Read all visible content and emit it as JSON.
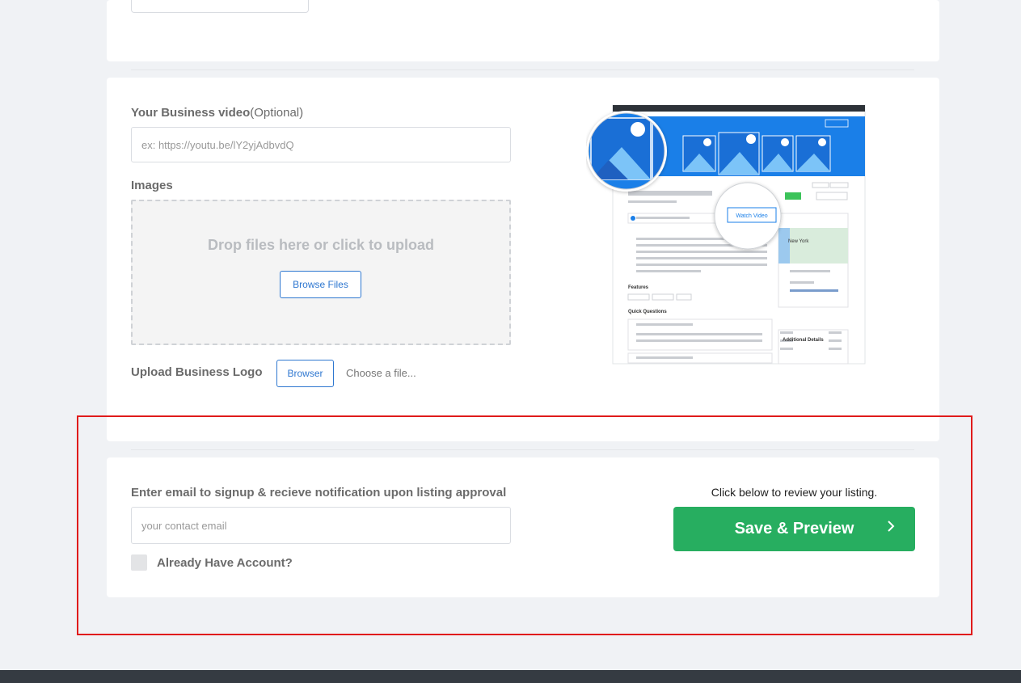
{
  "video": {
    "label": "Your Business video",
    "label_optional": "(Optional)",
    "placeholder": "ex: https://youtu.be/lY2yjAdbvdQ"
  },
  "images": {
    "label": "Images",
    "drop_text": "Drop files here or click to upload",
    "browse_label": "Browse Files"
  },
  "logo": {
    "label": "Upload Business Logo",
    "browse_label": "Browser",
    "file_text": "Choose a file..."
  },
  "preview": {
    "watch_video": "Watch Video",
    "features": "Features",
    "quick_questions": "Quick Questions",
    "additional_details": "Additional Details",
    "map_city": "New York"
  },
  "signup": {
    "label": "Enter email to signup & recieve notification upon listing approval",
    "email_placeholder": "your contact email",
    "account_label": "Already Have Account?"
  },
  "review": {
    "text": "Click below to review your listing.",
    "button_label": "Save & Preview",
    "button_icon": "chevron-right-icon"
  },
  "colors": {
    "accent_blue": "#2e77d0",
    "save_green": "#27ae60",
    "highlight_red": "#e01b1b",
    "footer": "#353b42"
  }
}
